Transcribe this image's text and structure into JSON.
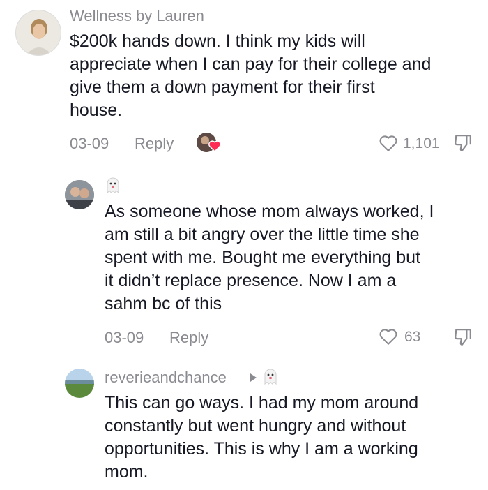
{
  "comments": [
    {
      "username": "Wellness by Lauren",
      "text_lines": [
        "$200k hands down. I think my kids will",
        "appreciate when I can pay for their college and",
        "give them a down payment for their first",
        "house."
      ],
      "date": "03-09",
      "reply_label": "Reply",
      "like_count": "1,101"
    },
    {
      "username": "",
      "text_lines": [
        "As someone whose mom always worked, I",
        "am still a bit angry over the little time she",
        "spent with me. Bought me everything but",
        "it didn’t replace presence. Now I am a",
        "sahm bc of this"
      ],
      "date": "03-09",
      "reply_label": "Reply",
      "like_count": "63"
    },
    {
      "username": "reverieandchance",
      "text_lines": [
        "This can go ways. I had my mom around",
        "constantly but went hungry and without",
        "opportunities. This is why I am a working",
        "mom."
      ]
    }
  ],
  "colors": {
    "text": "#161823",
    "muted": "#8a8b91",
    "heart_accent": "#fe2c55"
  },
  "icons": [
    "heart-outline-icon",
    "dislike-icon",
    "ghost-emoji-icon",
    "play-arrow-icon",
    "liked-by-creator-heart-icon"
  ]
}
